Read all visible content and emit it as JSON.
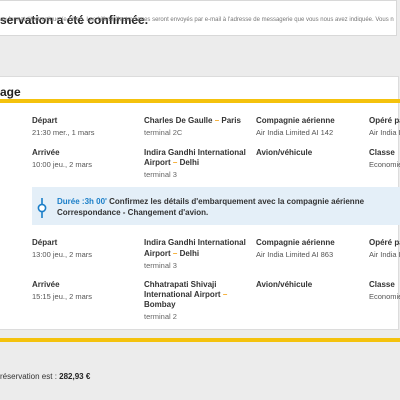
{
  "confirmation": {
    "title": "servation a été confirmée."
  },
  "notice": {
    "text": "au format électronique (e-billet). Les billets électroniques seront envoyés par e-mail à l'adresse de messagerie que vous nous avez indiquée. Vous n"
  },
  "itinerary": {
    "section_title": "age"
  },
  "flight1": {
    "departure_label": "Départ",
    "departure_time": "21:30 mer., 1 mars",
    "arrival_label": "Arrivée",
    "arrival_time": "10:00 jeu., 2 mars",
    "origin_airport": "Charles De Gaulle",
    "origin_separator": " – ",
    "origin_city": "Paris",
    "origin_terminal": "terminal 2C",
    "dest_airport_line1": "Indira Gandhi International",
    "dest_airport_line2": "Airport",
    "dest_separator": " – ",
    "dest_city": "Delhi",
    "dest_terminal": "terminal 3",
    "airline_label": "Compagnie aérienne",
    "airline_value": "Air India Limited AI 142",
    "aircraft_label": "Avion/véhicule",
    "operated_label": "Opéré pa",
    "operated_value": "Air India Li",
    "class_label": "Classe",
    "class_value": "Economie"
  },
  "connection": {
    "duration": "Durée :3h 00'",
    "message_line1": " Confirmez les détails d'embarquement avec la compagnie aérienne",
    "message_line2": "Correspondance - Changement d'avion."
  },
  "flight2": {
    "departure_label": "Départ",
    "departure_time": "13:00 jeu., 2 mars",
    "arrival_label": "Arrivée",
    "arrival_time": "15:15 jeu., 2 mars",
    "origin_airport_line1": "Indira Gandhi International",
    "origin_airport_line2": "Airport",
    "origin_separator": " – ",
    "origin_city": "Delhi",
    "origin_terminal": "terminal 3",
    "dest_airport_line1": "Chhatrapati Shivaji",
    "dest_airport_line2": "International Airport",
    "dest_separator": " –",
    "dest_city": "Bombay",
    "dest_terminal": "terminal 2",
    "airline_label": "Compagnie aérienne",
    "airline_value": "Air India Limited AI 863",
    "aircraft_label": "Avion/véhicule",
    "operated_label": "Opéré pa",
    "operated_value": "Air India Li",
    "class_label": "Classe",
    "class_value": "Economie"
  },
  "summary": {
    "total_label": "réservation est : ",
    "total_value": "282,93 €"
  },
  "colors": {
    "accent_yellow": "#f4c20d",
    "connection_bg": "#e4eff8",
    "duration_blue": "#1a7ec8",
    "separator_orange": "#f4a51f"
  },
  "icons": {
    "connection": "connection-route-icon"
  }
}
